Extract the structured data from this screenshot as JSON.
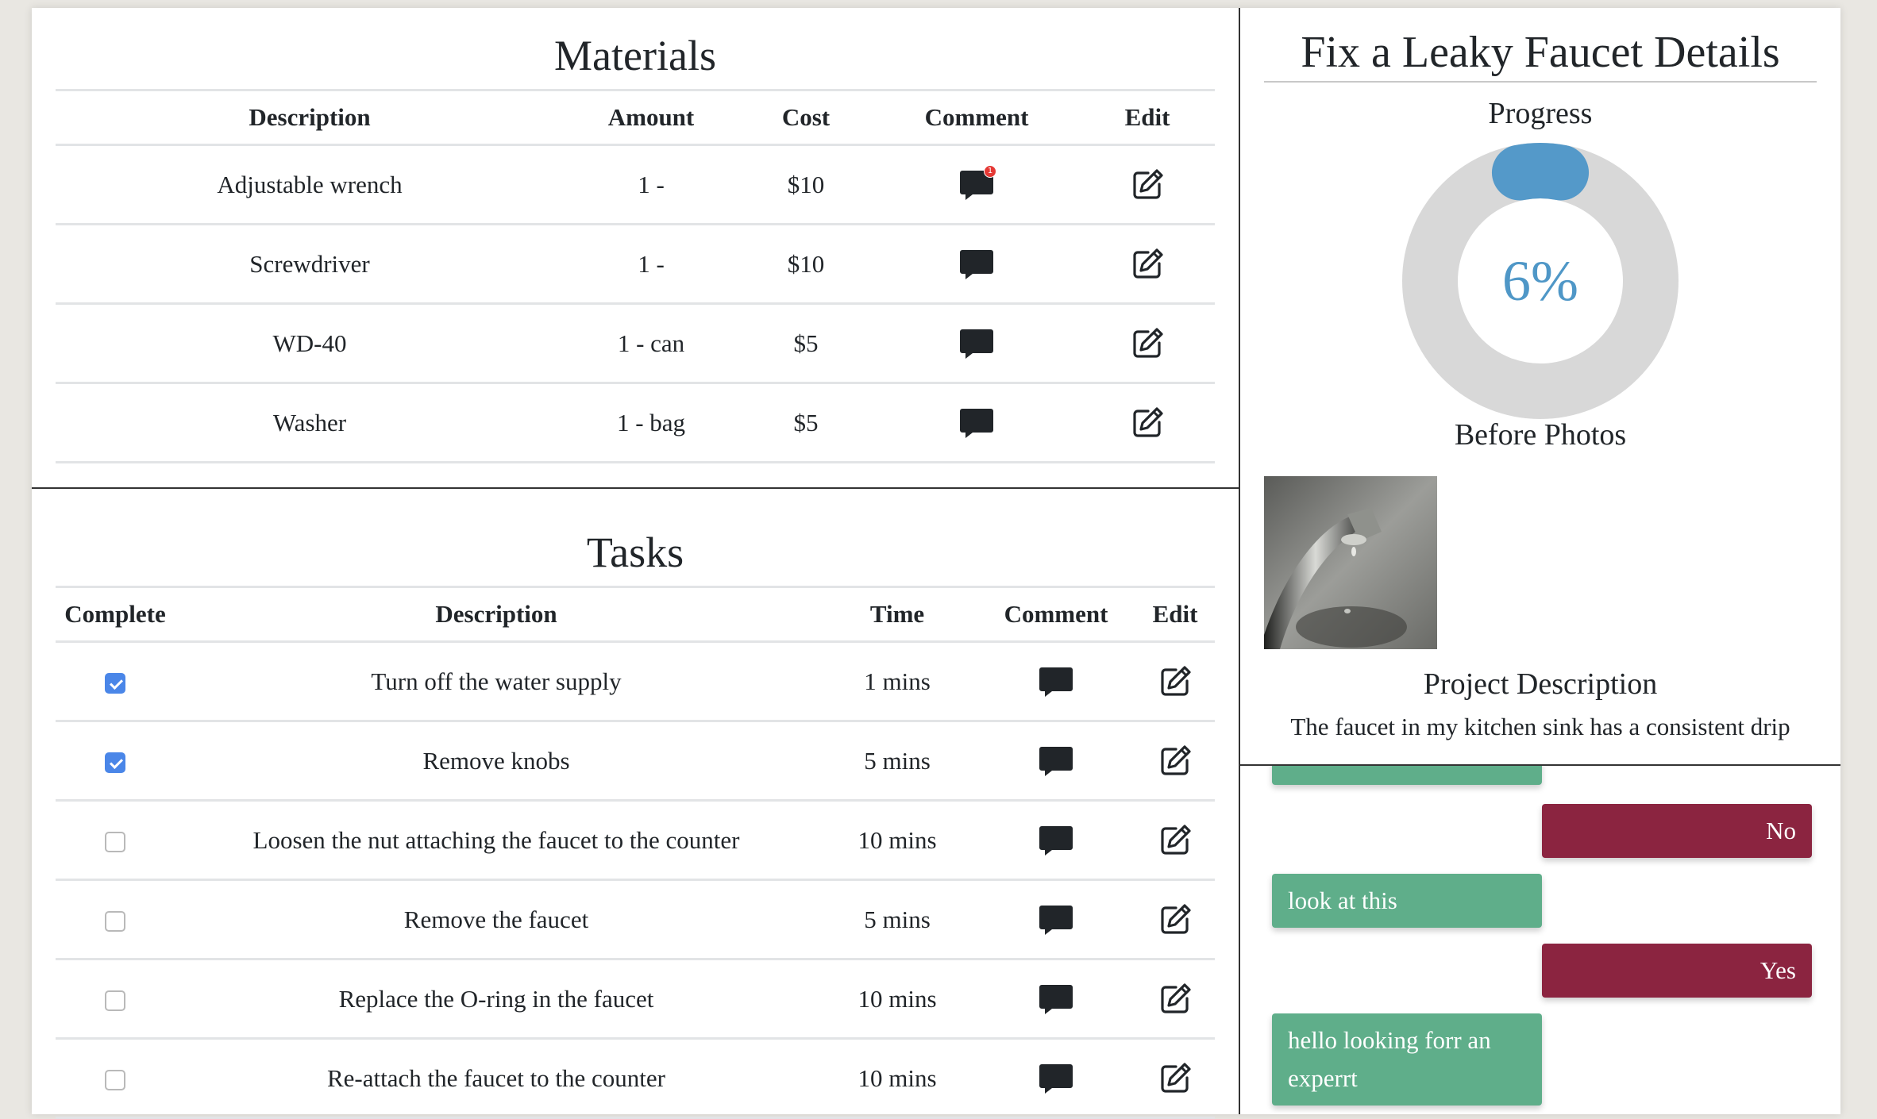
{
  "materials": {
    "title": "Materials",
    "headers": {
      "description": "Description",
      "amount": "Amount",
      "cost": "Cost",
      "comment": "Comment",
      "edit": "Edit"
    },
    "rows": [
      {
        "description": "Adjustable wrench",
        "amount": "1 -",
        "cost": "$10",
        "comment_badge": "1"
      },
      {
        "description": "Screwdriver",
        "amount": "1 -",
        "cost": "$10"
      },
      {
        "description": "WD-40",
        "amount": "1 - can",
        "cost": "$5"
      },
      {
        "description": "Washer",
        "amount": "1 - bag",
        "cost": "$5"
      }
    ]
  },
  "tasks": {
    "title": "Tasks",
    "headers": {
      "complete": "Complete",
      "description": "Description",
      "time": "Time",
      "comment": "Comment",
      "edit": "Edit"
    },
    "rows": [
      {
        "complete": true,
        "description": "Turn off the water supply",
        "time": "1 mins"
      },
      {
        "complete": true,
        "description": "Remove knobs",
        "time": "5 mins"
      },
      {
        "complete": false,
        "description": "Loosen the nut attaching the faucet to the counter",
        "time": "10 mins"
      },
      {
        "complete": false,
        "description": "Remove the faucet",
        "time": "5 mins"
      },
      {
        "complete": false,
        "description": "Replace the O-ring in the faucet",
        "time": "10 mins"
      },
      {
        "complete": false,
        "description": "Re-attach the faucet to the counter",
        "time": "10 mins"
      }
    ]
  },
  "details": {
    "title": "Fix a Leaky Faucet Details",
    "progress_label": "Progress",
    "progress_value": 6,
    "progress_text": "6%",
    "before_photos_label": "Before Photos",
    "project_description_label": "Project Description",
    "project_description": "The faucet in my kitchen sink has a consistent drip"
  },
  "chat": {
    "messages": [
      {
        "side": "theirs",
        "text": ""
      },
      {
        "side": "mine",
        "text": "No"
      },
      {
        "side": "theirs",
        "text": "look at this"
      },
      {
        "side": "mine",
        "text": "Yes"
      },
      {
        "side": "theirs",
        "text": "hello looking forr an experrt"
      }
    ]
  },
  "colors": {
    "progress_fill": "#5499c9",
    "progress_track": "#d8d8d8",
    "message_theirs": "#5fae8a",
    "message_mine": "#8b2440",
    "checkbox_checked": "#4a86e8"
  },
  "icons": {
    "comment": "chat-bubble-icon",
    "edit": "edit-square-icon"
  }
}
